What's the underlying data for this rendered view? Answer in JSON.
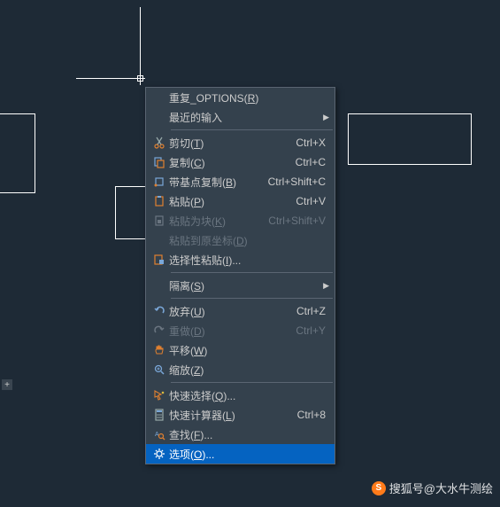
{
  "menu": {
    "items": [
      {
        "label_pre": "重复_OPTIONS(",
        "u": "R",
        "label_post": ")",
        "icon": null,
        "shortcut": "",
        "enabled": true,
        "submenu": false,
        "selected": false
      },
      {
        "label_pre": "最近的输入",
        "u": "",
        "label_post": "",
        "icon": null,
        "shortcut": "",
        "enabled": true,
        "submenu": true,
        "selected": false
      },
      "---",
      {
        "label_pre": "剪切(",
        "u": "T",
        "label_post": ")",
        "icon": "cut",
        "shortcut": "Ctrl+X",
        "enabled": true,
        "submenu": false,
        "selected": false
      },
      {
        "label_pre": "复制(",
        "u": "C",
        "label_post": ")",
        "icon": "copy",
        "shortcut": "Ctrl+C",
        "enabled": true,
        "submenu": false,
        "selected": false
      },
      {
        "label_pre": "带基点复制(",
        "u": "B",
        "label_post": ")",
        "icon": "copybase",
        "shortcut": "Ctrl+Shift+C",
        "enabled": true,
        "submenu": false,
        "selected": false
      },
      {
        "label_pre": "粘贴(",
        "u": "P",
        "label_post": ")",
        "icon": "paste",
        "shortcut": "Ctrl+V",
        "enabled": true,
        "submenu": false,
        "selected": false
      },
      {
        "label_pre": "粘贴为块(",
        "u": "K",
        "label_post": ")",
        "icon": "pasteblock",
        "shortcut": "Ctrl+Shift+V",
        "enabled": false,
        "submenu": false,
        "selected": false
      },
      {
        "label_pre": "粘贴到原坐标(",
        "u": "D",
        "label_post": ")",
        "icon": null,
        "shortcut": "",
        "enabled": false,
        "submenu": false,
        "selected": false
      },
      {
        "label_pre": "选择性粘贴(",
        "u": "I",
        "label_post": ")...",
        "icon": "pastespecial",
        "shortcut": "",
        "enabled": true,
        "submenu": false,
        "selected": false
      },
      "---",
      {
        "label_pre": "隔离(",
        "u": "S",
        "label_post": ")",
        "icon": null,
        "shortcut": "",
        "enabled": true,
        "submenu": true,
        "selected": false
      },
      "---",
      {
        "label_pre": "放弃(",
        "u": "U",
        "label_post": ")",
        "icon": "undo",
        "shortcut": "Ctrl+Z",
        "enabled": true,
        "submenu": false,
        "selected": false
      },
      {
        "label_pre": "重做(",
        "u": "D",
        "label_post": ")",
        "icon": "redo",
        "shortcut": "Ctrl+Y",
        "enabled": false,
        "submenu": false,
        "selected": false
      },
      {
        "label_pre": "平移(",
        "u": "W",
        "label_post": ")",
        "icon": "pan",
        "shortcut": "",
        "enabled": true,
        "submenu": false,
        "selected": false
      },
      {
        "label_pre": "缩放(",
        "u": "Z",
        "label_post": ")",
        "icon": "zoom",
        "shortcut": "",
        "enabled": true,
        "submenu": false,
        "selected": false
      },
      "---",
      {
        "label_pre": "快速选择(",
        "u": "Q",
        "label_post": ")...",
        "icon": "qselect",
        "shortcut": "",
        "enabled": true,
        "submenu": false,
        "selected": false
      },
      {
        "label_pre": "快速计算器(",
        "u": "L",
        "label_post": ")",
        "icon": "calc",
        "shortcut": "Ctrl+8",
        "enabled": true,
        "submenu": false,
        "selected": false
      },
      {
        "label_pre": "查找(",
        "u": "F",
        "label_post": ")...",
        "icon": "find",
        "shortcut": "",
        "enabled": true,
        "submenu": false,
        "selected": false
      },
      {
        "label_pre": "选项(",
        "u": "O",
        "label_post": ")...",
        "icon": "options",
        "shortcut": "",
        "enabled": true,
        "submenu": false,
        "selected": true
      }
    ]
  },
  "watermark": {
    "text": "搜狐号@大水牛测绘"
  }
}
